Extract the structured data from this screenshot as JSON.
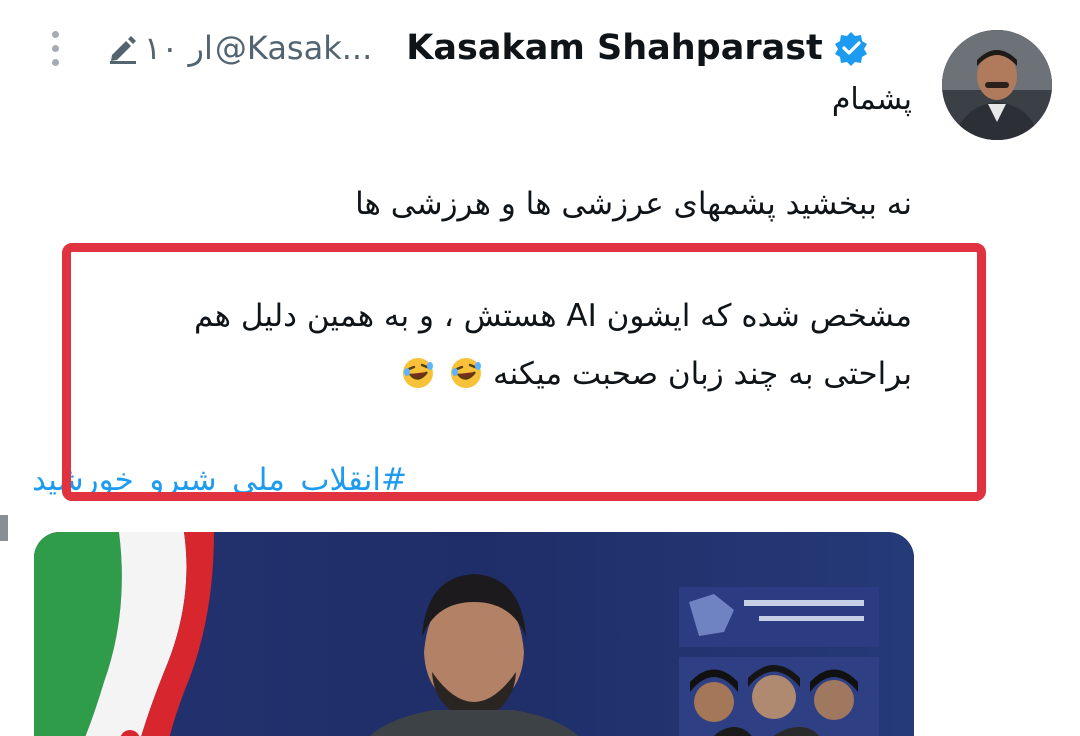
{
  "tweet": {
    "author": {
      "display_name": "Kasakam Shahparast",
      "handle": "@Kasak...",
      "avatar_icon": "avatar-photo",
      "verified_icon": "verified-badge-icon"
    },
    "time": "۱۰ ار",
    "edited_icon": "edit-pencil-icon",
    "more_icon": "more-vertical-icon",
    "reply_label": "پشمام",
    "lines": [
      "نه ببخشید پشمهای عرزشی ها و هرزشی ها",
      "مشخص شده که ایشون AI هستش ، و به همین دلیل هم",
      "براحتی  به چند زبان صحبت میکنه"
    ],
    "emojis": [
      "rofl-emoji",
      "rofl-emoji"
    ],
    "hashtag": "#انقلاب_ملی_شیرو_خورشید",
    "media_alt": "photo"
  },
  "annotation": {
    "box_color": "#e0323f"
  },
  "colors": {
    "text": "#0f1419",
    "muted": "#536471",
    "link": "#1d9bf0",
    "verified": "#1d9bf0"
  }
}
